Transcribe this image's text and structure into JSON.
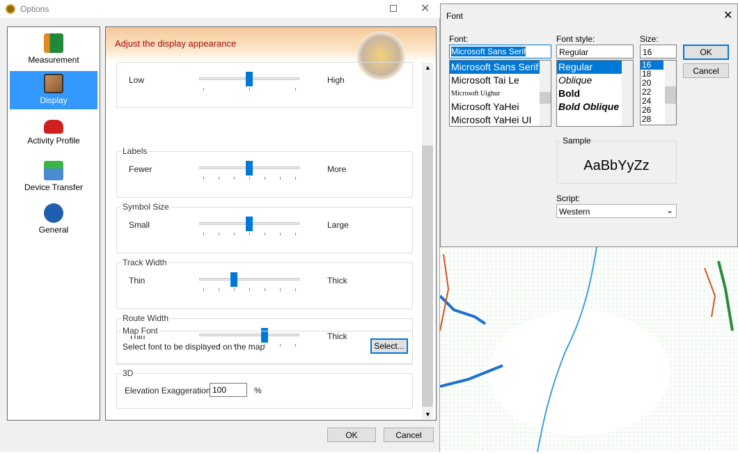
{
  "options": {
    "title": "Options",
    "sidebar": [
      {
        "label": "Measurement",
        "icon": "measurement-icon",
        "selected": false
      },
      {
        "label": "Display",
        "icon": "display-icon",
        "selected": true
      },
      {
        "label": "Activity Profile",
        "icon": "car-icon",
        "selected": false
      },
      {
        "label": "Device Transfer",
        "icon": "device-transfer-icon",
        "selected": false
      },
      {
        "label": "General",
        "icon": "gear-icon",
        "selected": false
      }
    ],
    "header": "Adjust the display appearance",
    "groups": [
      {
        "legend": "",
        "min": "Low",
        "max": "High",
        "value_fraction": 0.5,
        "ticks": 3
      },
      {
        "legend": "Labels",
        "min": "Fewer",
        "max": "More",
        "value_fraction": 0.5,
        "ticks": 7
      },
      {
        "legend": "Symbol Size",
        "min": "Small",
        "max": "Large",
        "value_fraction": 0.5,
        "ticks": 7
      },
      {
        "legend": "Track Width",
        "min": "Thin",
        "max": "Thick",
        "value_fraction": 0.333,
        "ticks": 7
      },
      {
        "legend": "Route Width",
        "min": "Thin",
        "max": "Thick",
        "value_fraction": 0.667,
        "ticks": 7
      }
    ],
    "map_font": {
      "legend": "Map Font",
      "text": "Select font to be displayed on the map",
      "button": "Select..."
    },
    "three_d": {
      "legend": "3D",
      "label": "Elevation Exaggeration:",
      "value": "100",
      "unit": "%"
    },
    "ok": "OK",
    "cancel": "Cancel"
  },
  "font_dialog": {
    "title": "Font",
    "font_label": "Font:",
    "font_value": "Microsoft Sans Serif",
    "fonts": [
      "Microsoft Sans Serif",
      "Microsoft Tai Le",
      "Microsoft Uighur",
      "Microsoft YaHei",
      "Microsoft YaHei UI"
    ],
    "style_label": "Font style:",
    "style_value": "Regular",
    "styles": [
      "Regular",
      "Oblique",
      "Bold",
      "Bold Oblique"
    ],
    "size_label": "Size:",
    "size_value": "16",
    "sizes": [
      "16",
      "18",
      "20",
      "22",
      "24",
      "26",
      "28"
    ],
    "ok": "OK",
    "cancel": "Cancel",
    "sample_label": "Sample",
    "sample_text": "AaBbYyZz",
    "script_label": "Script:",
    "script_value": "Western"
  }
}
